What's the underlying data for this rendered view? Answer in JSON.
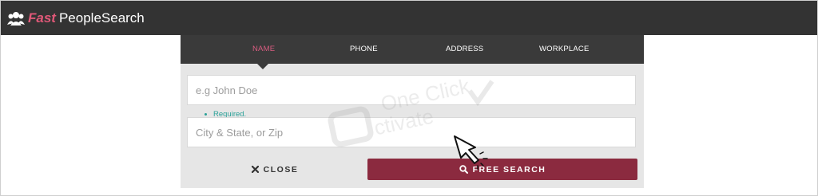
{
  "brand": {
    "fast": "Fast",
    "rest": "PeopleSearch"
  },
  "tabs": [
    {
      "label": "NAME",
      "active": true
    },
    {
      "label": "PHONE",
      "active": false
    },
    {
      "label": "ADDRESS",
      "active": false
    },
    {
      "label": "WORKPLACE",
      "active": false
    }
  ],
  "form": {
    "name_placeholder": "e.g John Doe",
    "name_value": "",
    "required_text": "Required.",
    "location_placeholder": "City & State, or Zip",
    "location_value": ""
  },
  "buttons": {
    "close_label": "CLOSE",
    "search_label": "FREE SEARCH"
  },
  "watermark": {
    "line1": "One Click",
    "line2": "ctivate"
  },
  "colors": {
    "topbar": "#333333",
    "tabs_bg": "#3a3a3a",
    "accent": "#d85c80",
    "search_button": "#8b2a3f",
    "required": "#2aa198"
  },
  "icons": {
    "logo": "people-group-icon",
    "close": "close-icon",
    "search": "search-icon",
    "cursor": "hand-cursor-icon"
  }
}
